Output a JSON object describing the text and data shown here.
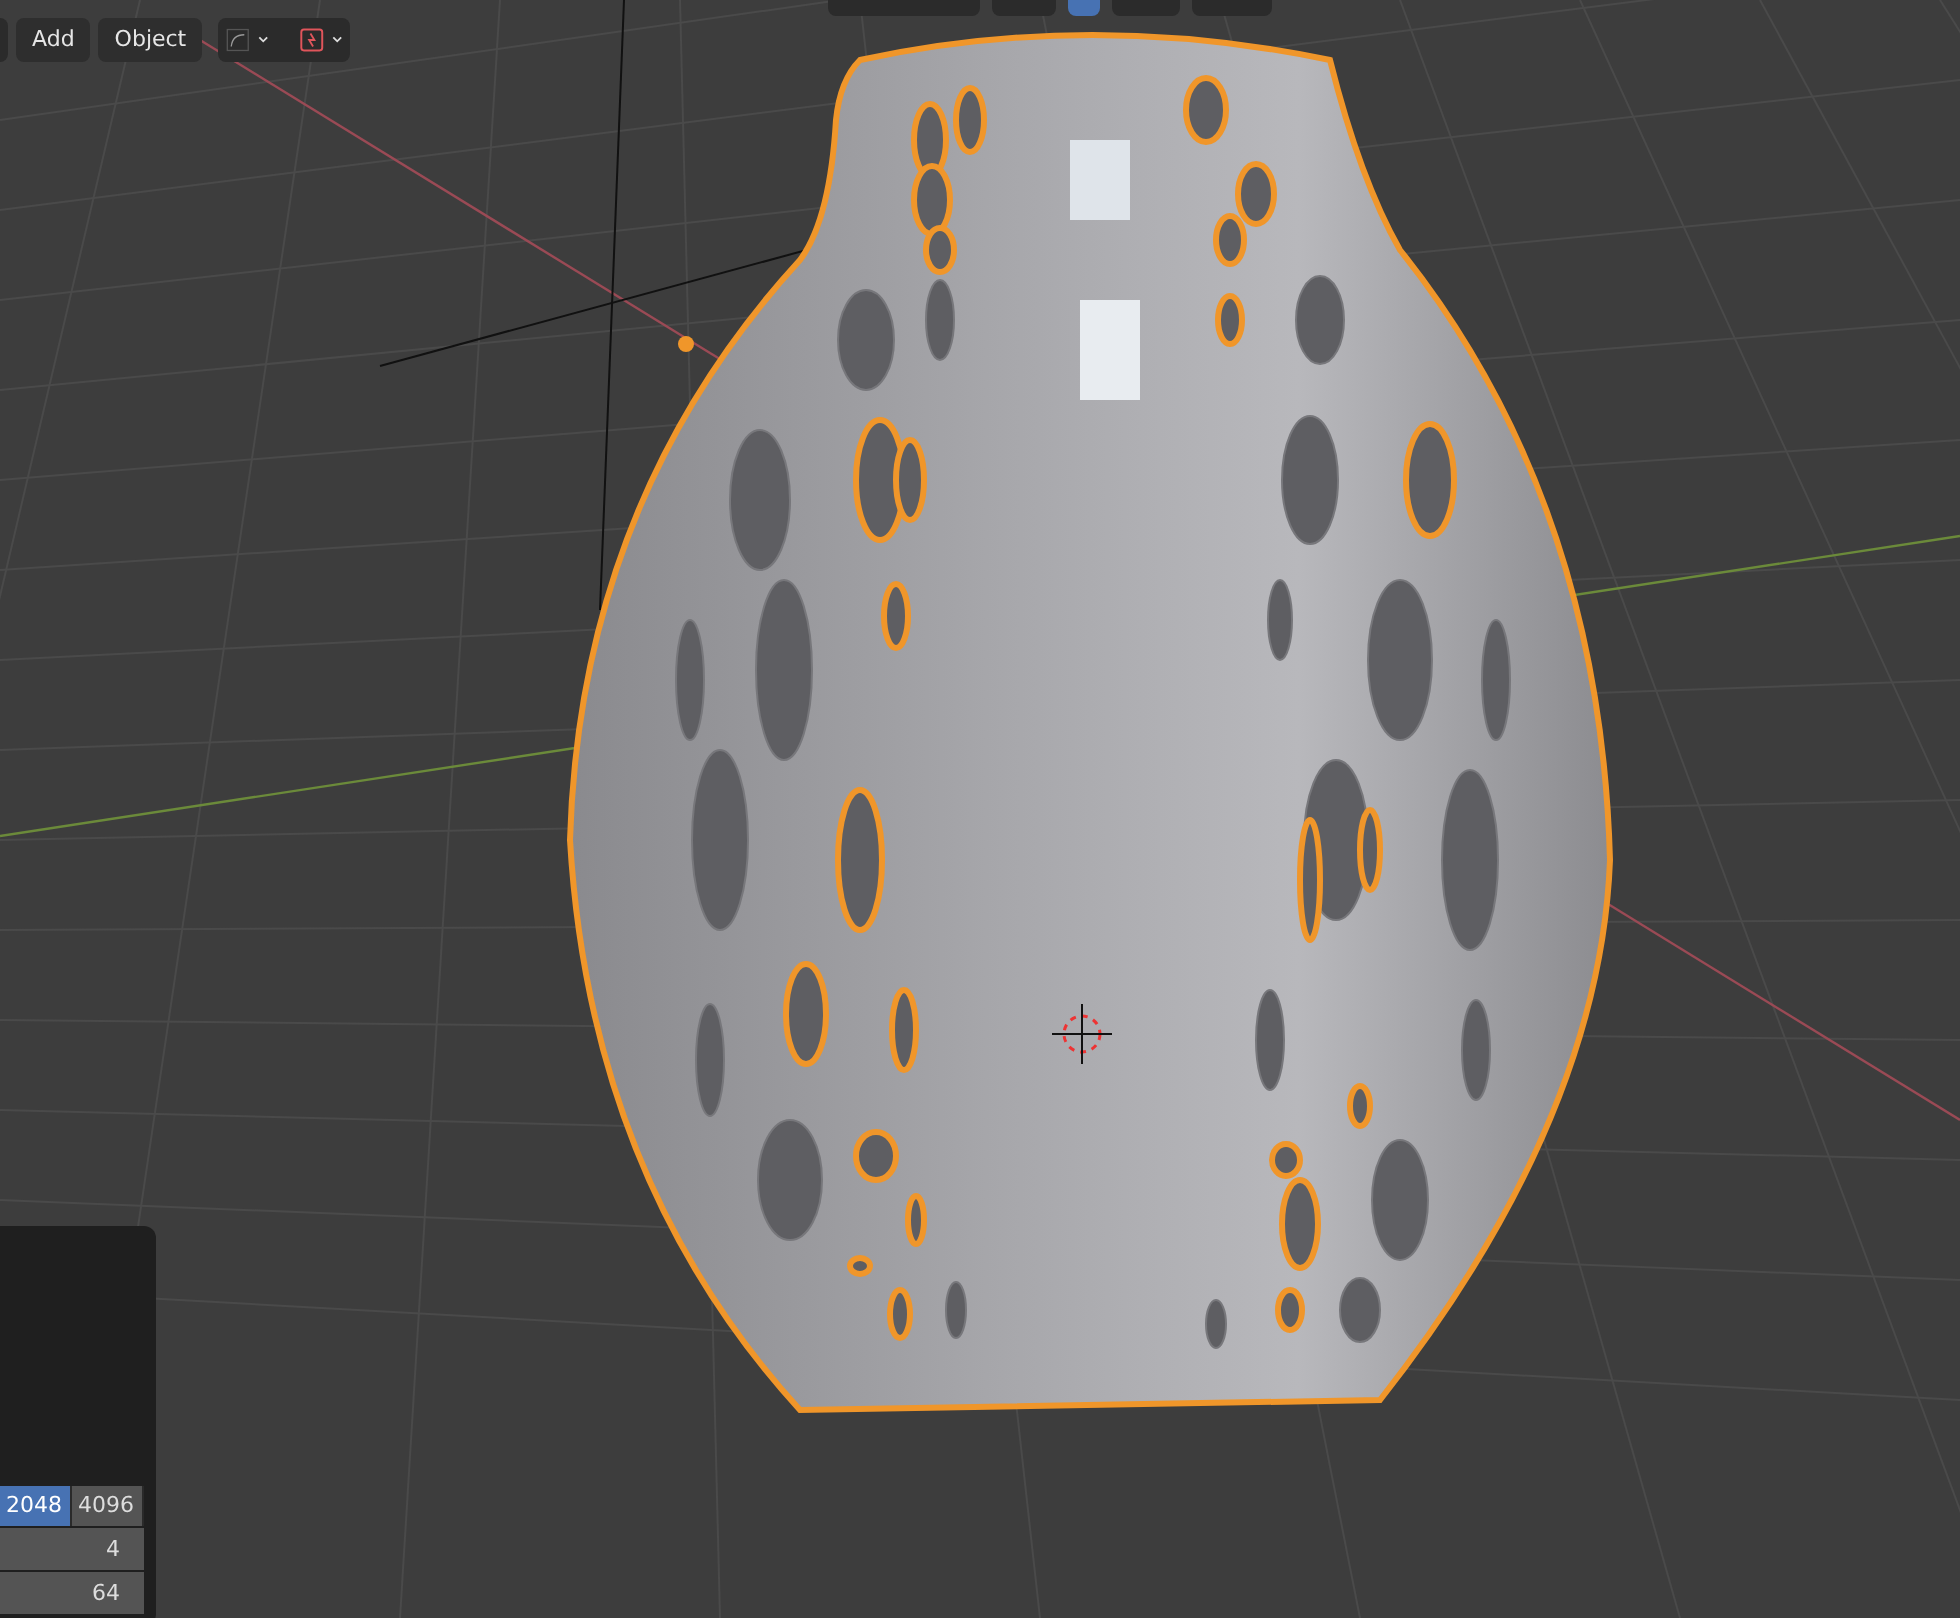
{
  "header": {
    "menus": [
      {
        "label": "Add"
      },
      {
        "label": "Object"
      }
    ],
    "toggles": [
      {
        "kind": "snap",
        "on": true
      },
      {
        "kind": "proportional",
        "on": false
      }
    ]
  },
  "popover": {
    "resolution_options": [
      {
        "label": "2048",
        "selected": true
      },
      {
        "label": "4096",
        "selected": false
      }
    ],
    "fields": [
      {
        "value": "4"
      },
      {
        "value": "64"
      }
    ]
  }
}
